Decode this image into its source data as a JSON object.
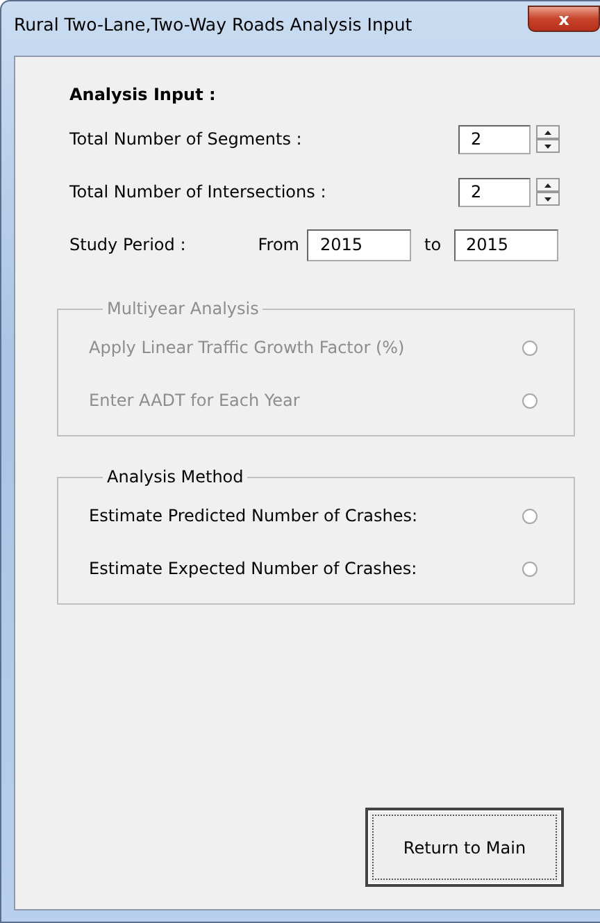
{
  "window": {
    "title": "Rural Two-Lane,Two-Way Roads Analysis Input",
    "close": "x"
  },
  "analysis_input": {
    "heading": "Analysis Input :",
    "spinners": [
      {
        "label": "Total Number of Segments :",
        "value": "2"
      },
      {
        "label": "Total Number of Intersections :",
        "value": "2"
      }
    ],
    "study_period": {
      "label": "Study Period :",
      "from_label": "From",
      "from": "2015",
      "to_label": "to",
      "to": "2015"
    }
  },
  "groups": [
    {
      "title": "Multiyear Analysis",
      "disabled": true,
      "options": [
        {
          "label": "Apply Linear Traffic Growth Factor (%)",
          "selected": false
        },
        {
          "label": "Enter AADT for Each Year",
          "selected": false
        }
      ]
    },
    {
      "title": "Analysis Method",
      "disabled": false,
      "options": [
        {
          "label": "Estimate Predicted Number of Crashes:",
          "selected": false
        },
        {
          "label": "Estimate Expected Number of Crashes:",
          "selected": false
        }
      ]
    }
  ],
  "buttons": [
    {
      "label": "Return to Main",
      "focused": true
    }
  ]
}
